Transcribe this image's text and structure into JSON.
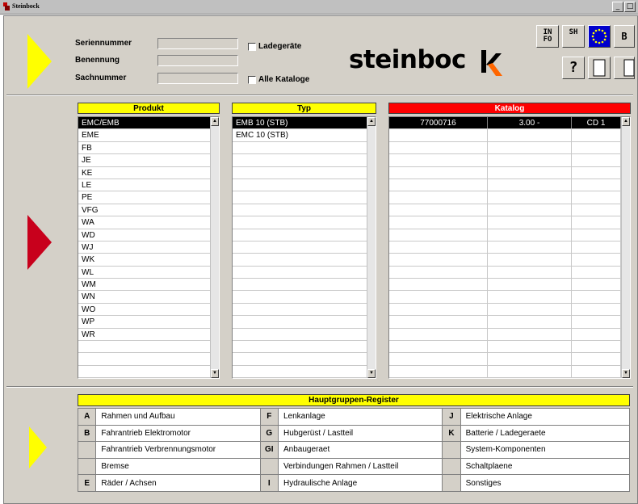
{
  "window": {
    "title": "Steinbock",
    "minimize": "_",
    "maximize": "□"
  },
  "form": {
    "serial_label": "Seriennummer",
    "name_label": "Benennung",
    "part_label": "Sachnummer",
    "chargers_label": "Ladegeräte",
    "all_catalogs_label": "Alle Kataloge"
  },
  "logo": {
    "text": "steinboc"
  },
  "toolbar": {
    "info": "IN\nFO",
    "sh": "SH",
    "help": "?",
    "back": "B"
  },
  "produkt": {
    "header": "Produkt",
    "items": [
      "EMC/EMB",
      "EME",
      "FB",
      "JE",
      "KE",
      "LE",
      "PE",
      "VFG",
      "WA",
      "WD",
      "WJ",
      "WK",
      "WL",
      "WM",
      "WN",
      "WO",
      "WP",
      "WR"
    ],
    "selected_index": 0
  },
  "typ": {
    "header": "Typ",
    "items": [
      "EMB 10 (STB)",
      "EMC 10 (STB)"
    ],
    "selected_index": 0
  },
  "katalog": {
    "header": "Katalog",
    "rows": [
      {
        "number": "77000716",
        "version": "3.00 -",
        "medium": "CD 1"
      }
    ]
  },
  "hauptgruppen": {
    "header": "Hauptgruppen-Register",
    "rows": [
      [
        {
          "key": "A",
          "label": "Rahmen und Aufbau"
        },
        {
          "key": "F",
          "label": "Lenkanlage"
        },
        {
          "key": "J",
          "label": "Elektrische Anlage"
        }
      ],
      [
        {
          "key": "B",
          "label": "Fahrantrieb Elektromotor"
        },
        {
          "key": "G",
          "label": "Hubgerüst / Lastteil"
        },
        {
          "key": "K",
          "label": "Batterie / Ladegeraete"
        }
      ],
      [
        {
          "key": "",
          "label": "Fahrantrieb Verbrennungsmotor"
        },
        {
          "key": "GI",
          "label": "Anbaugeraet"
        },
        {
          "key": "",
          "label": "System-Komponenten"
        }
      ],
      [
        {
          "key": "",
          "label": "Bremse"
        },
        {
          "key": "",
          "label": "Verbindungen Rahmen / Lastteil"
        },
        {
          "key": "",
          "label": "Schaltplaene"
        }
      ],
      [
        {
          "key": "E",
          "label": "Räder / Achsen"
        },
        {
          "key": "I",
          "label": "Hydraulische Anlage"
        },
        {
          "key": "",
          "label": "Sonstiges"
        }
      ]
    ]
  },
  "colors": {
    "yellow": "#ffff00",
    "red": "#ff0000",
    "arrow_red": "#c8001c",
    "panel": "#d4d0c8",
    "logo_accent": "#ff6600",
    "eu_blue": "#0000cc"
  }
}
